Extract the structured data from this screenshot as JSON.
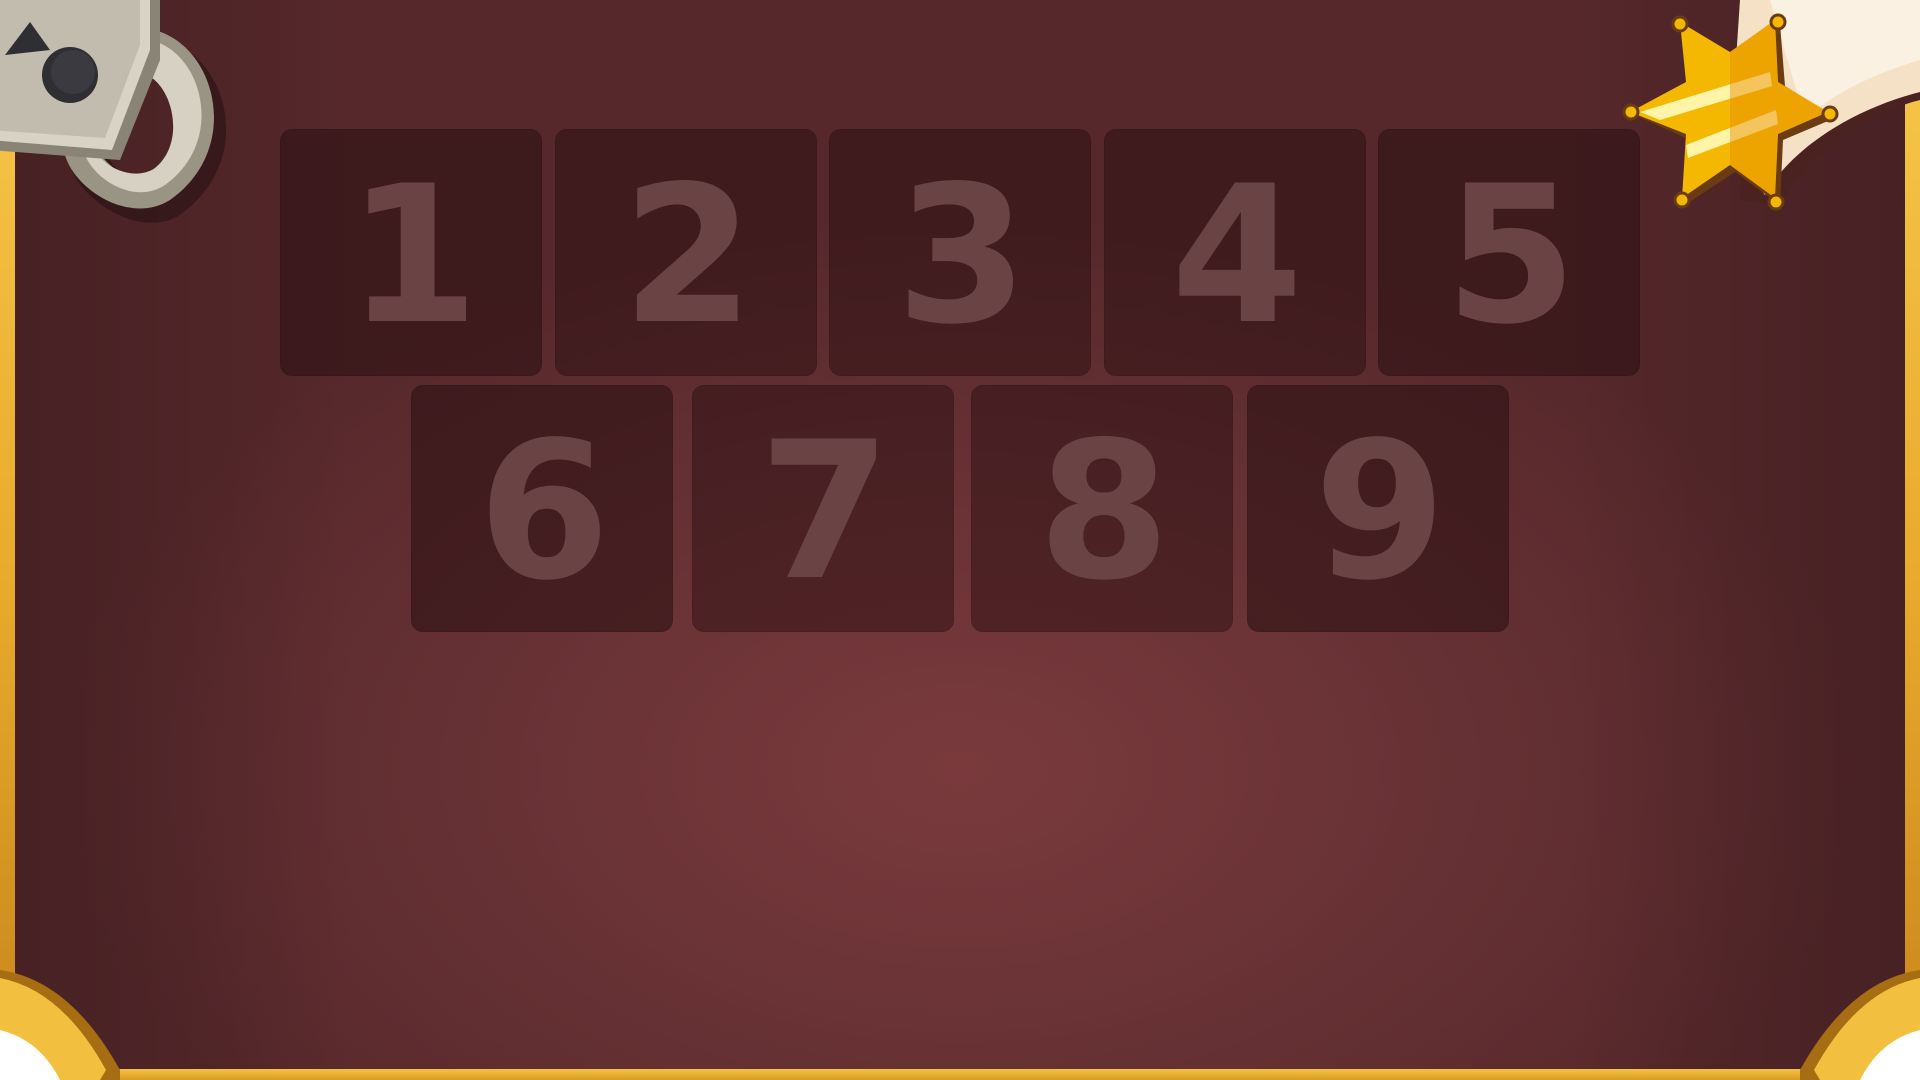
{
  "level_select": {
    "rows": [
      [
        "1",
        "2",
        "3",
        "4",
        "5"
      ],
      [
        "6",
        "7",
        "8",
        "9"
      ]
    ],
    "tile_color": "#6a4445",
    "tiles_locked": true
  },
  "theme": {
    "board_color": "#6a3336",
    "frame_gold": "#e9a92c",
    "badge_gold": "#f5b800"
  },
  "icons": {
    "top_left": "padlock-icon",
    "top_right": "sheriff-star-badge-icon"
  }
}
